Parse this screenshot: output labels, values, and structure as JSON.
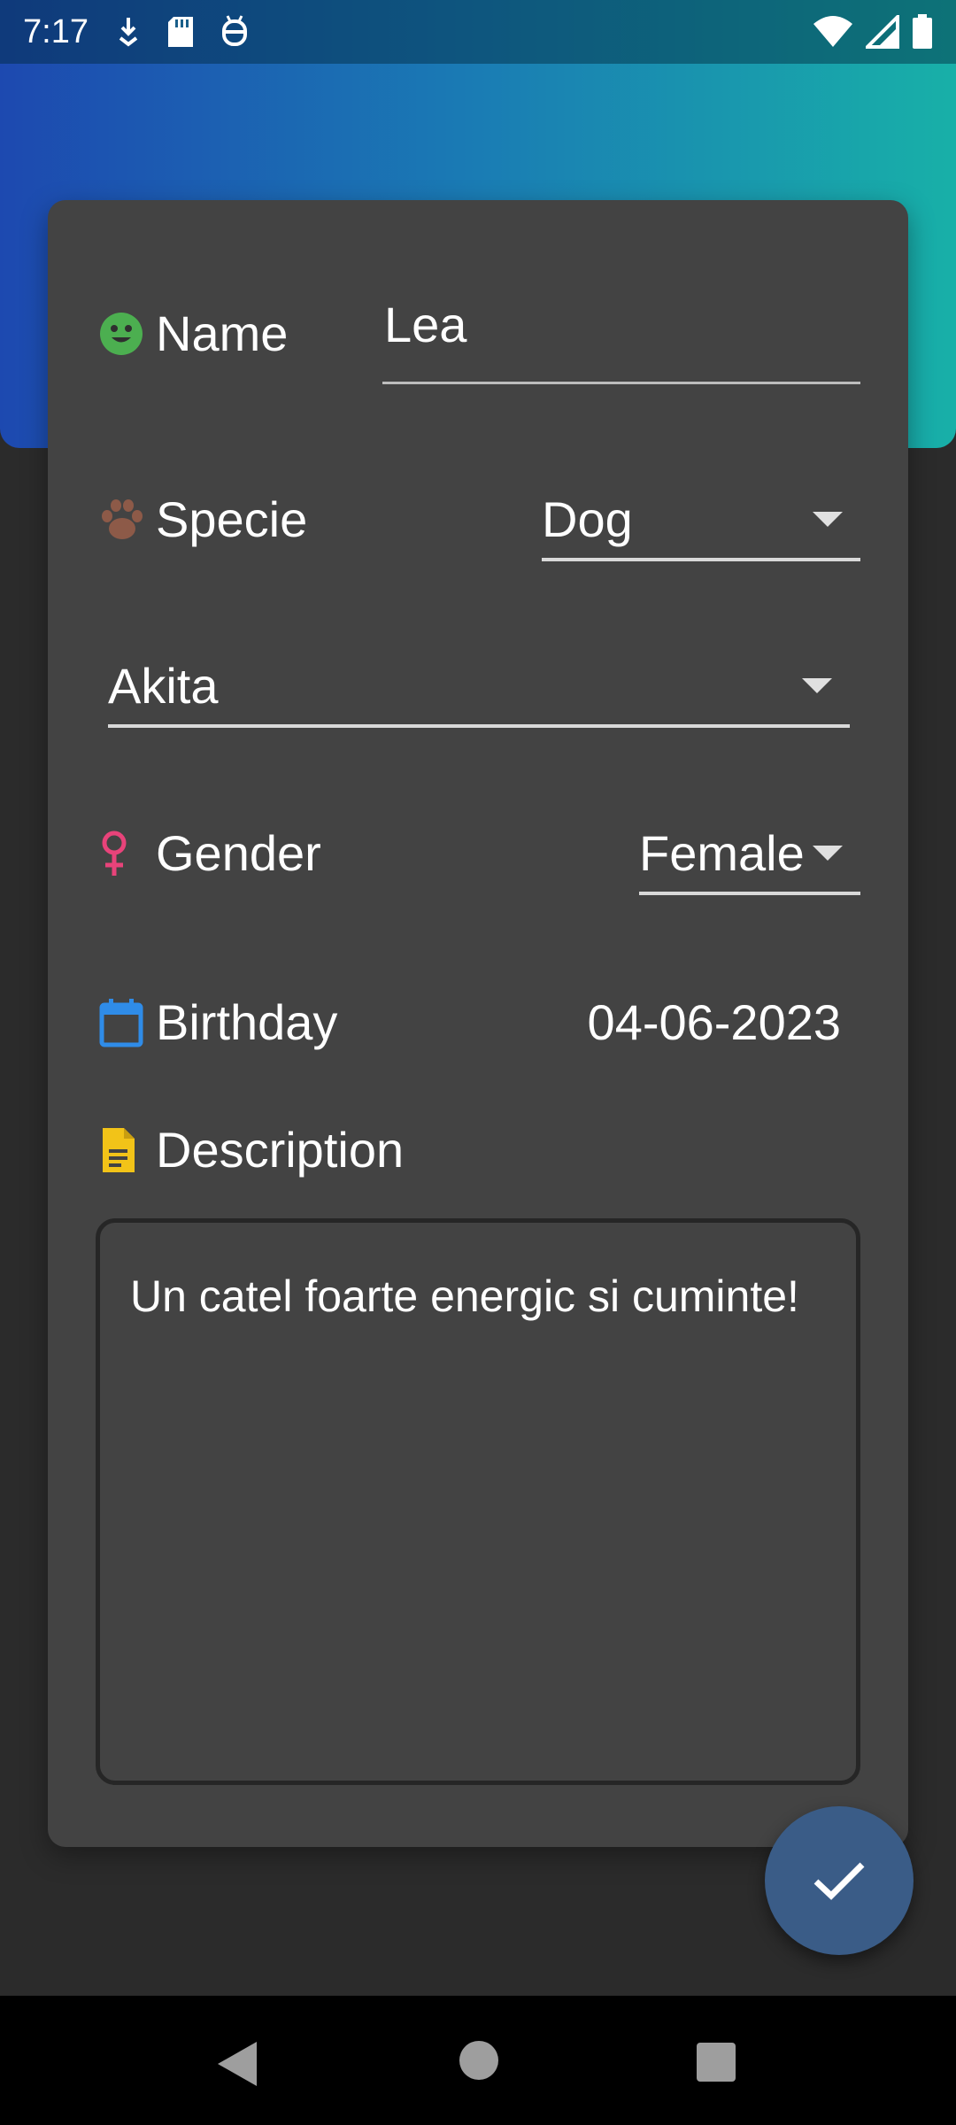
{
  "status_bar": {
    "time": "7:17",
    "left_icons": [
      "download-icon",
      "sd-card-icon",
      "android-debug-icon"
    ],
    "right_icons": [
      "wifi-icon",
      "signal-icon",
      "battery-icon"
    ]
  },
  "form": {
    "name": {
      "label": "Name",
      "icon": "smiley-icon",
      "value": "Lea",
      "icon_color": "#4caf50"
    },
    "specie": {
      "label": "Specie",
      "icon": "paw-icon",
      "value": "Dog",
      "icon_color": "#8d5a48"
    },
    "breed": {
      "value": "Akita"
    },
    "gender": {
      "label": "Gender",
      "icon": "female-icon",
      "value": "Female",
      "icon_color": "#e8437a"
    },
    "birthday": {
      "label": "Birthday",
      "icon": "calendar-icon",
      "value": "04-06-2023",
      "icon_color": "#2f8ce8"
    },
    "description": {
      "label": "Description",
      "icon": "document-icon",
      "value": "Un catel foarte energic si cuminte!",
      "icon_color": "#f2c318"
    }
  },
  "fab": {
    "icon": "check-icon"
  },
  "nav": {
    "buttons": [
      "back-icon",
      "home-icon",
      "recents-icon"
    ]
  },
  "colors": {
    "header_gradient_start": "#1d49b0",
    "header_gradient_end": "#18b0a8",
    "card_bg": "#434343",
    "page_bg": "#2b2b2b",
    "fab_bg": "#3a5c87"
  }
}
